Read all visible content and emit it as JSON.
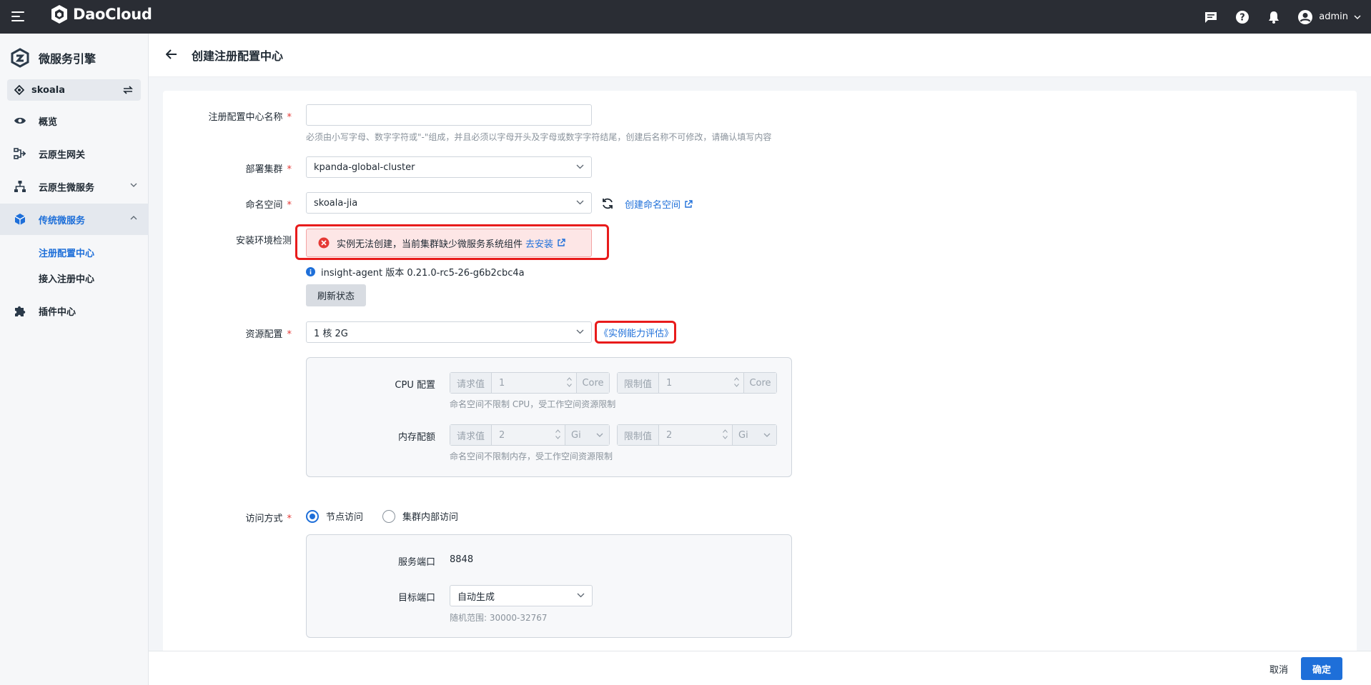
{
  "topbar": {
    "brand": "DaoCloud",
    "user": "admin"
  },
  "sidebar": {
    "title": "微服务引擎",
    "workspace": "skoala",
    "items": [
      {
        "label": "概览"
      },
      {
        "label": "云原生网关"
      },
      {
        "label": "云原生微服务"
      },
      {
        "label": "传统微服务"
      },
      {
        "label": "插件中心"
      }
    ],
    "sub_items": [
      {
        "label": "注册配置中心"
      },
      {
        "label": "接入注册中心"
      }
    ]
  },
  "header": {
    "title": "创建注册配置中心"
  },
  "form": {
    "name": {
      "label": "注册配置中心名称",
      "value": "",
      "hint": "必须由小写字母、数字字符或\"-\"组成，并且必须以字母开头及字母或数字字符结尾，创建后名称不可修改，请确认填写内容"
    },
    "cluster": {
      "label": "部署集群",
      "value": "kpanda-global-cluster"
    },
    "namespace": {
      "label": "命名空间",
      "value": "skoala-jia",
      "create_link": "创建命名空间"
    },
    "env": {
      "label": "安装环境检测",
      "error": "实例无法创建，当前集群缺少微服务系统组件",
      "install_link": "去安装",
      "info": "insight-agent 版本 0.21.0-rc5-26-g6b2cbc4a",
      "refresh": "刷新状态"
    },
    "resource": {
      "label": "资源配置",
      "value": "1 核 2G",
      "eval_link": "《实例能力评估》",
      "cpu": {
        "label": "CPU 配置",
        "request_label": "请求值",
        "request_value": "1",
        "request_unit": "Core",
        "limit_label": "限制值",
        "limit_value": "1",
        "limit_unit": "Core",
        "hint": "命名空间不限制 CPU，受工作空间资源限制"
      },
      "memory": {
        "label": "内存配额",
        "request_label": "请求值",
        "request_value": "2",
        "request_unit": "Gi",
        "limit_label": "限制值",
        "limit_value": "2",
        "limit_unit": "Gi",
        "hint": "命名空间不限制内存，受工作空间资源限制"
      }
    },
    "access": {
      "label": "访问方式",
      "options": [
        "节点访问",
        "集群内部访问"
      ],
      "selected": "节点访问",
      "service_port_label": "服务端口",
      "service_port": "8848",
      "target_port_label": "目标端口",
      "target_port": "自动生成",
      "target_hint": "随机范围: 30000-32767"
    }
  },
  "footer": {
    "cancel": "取消",
    "ok": "确定"
  }
}
